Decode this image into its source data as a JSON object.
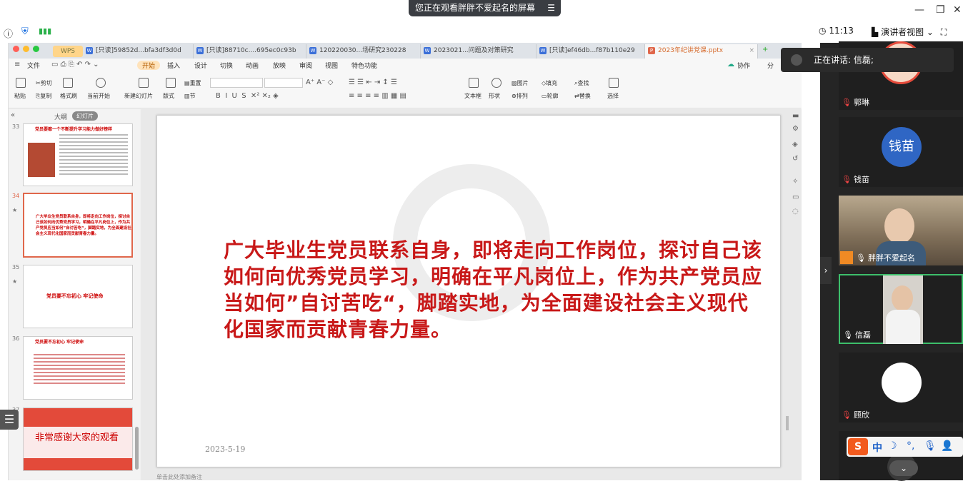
{
  "meeting": {
    "share_banner": "您正在观看胖胖不爱起名的屏幕",
    "banner_menu_icon": "menu-icon",
    "time": "11:13",
    "presenter_view_label": "演讲者视图",
    "speaking_label": "正在讲话:  信磊;"
  },
  "wps": {
    "app_tab": "WPS",
    "tabs": [
      "[只读]59852d...bfa3df3d0d",
      "[只读]88710c....695ec0c93b",
      "120220030...场研究230228",
      "2023021...问题及对策研究",
      "[只读]ef46db...f87b110e29",
      "2023年纪讲党课.pptx"
    ],
    "menu": [
      "文件",
      "开始",
      "插入",
      "设计",
      "切换",
      "动画",
      "放映",
      "审阅",
      "视图",
      "特色功能"
    ],
    "menu_right": [
      "协作",
      "分"
    ],
    "ribbon": {
      "paste": "粘贴",
      "cut": "剪切",
      "copy": "复制",
      "format_brush": "格式刷",
      "play_from_current": "当前开始",
      "new_slide": "新建幻灯片",
      "layout": "版式",
      "section": "节",
      "reset": "重置",
      "textbox": "文本框",
      "shape": "形状",
      "arrange": "排列",
      "picture": "图片",
      "fill": "填充",
      "outline": "轮廓",
      "find": "查找",
      "replace": "替换",
      "select": "选择"
    },
    "panel_tabs": {
      "outline": "大纲",
      "slides": "幻灯片"
    },
    "slides": [
      {
        "num": "33",
        "title": "党员要都一个不断提升学习能力做好榜样"
      },
      {
        "num": "34",
        "text": "广大毕业生党员联系自身，即将走向工作岗位，探讨自己该如何向优秀党员学习，明确在平凡岗位上，作为共产党员应当如何”自讨苦吃“，脚踏实地，为全面建设社会主义现代化国家而贡献青春力量。"
      },
      {
        "num": "35",
        "text": "党员要不忘初心 牢记使命"
      },
      {
        "num": "36",
        "title": "党员要不忘初心 牢记使命"
      },
      {
        "num": "37",
        "text": "非常感谢大家的观看"
      }
    ],
    "current_slide": {
      "body": "广大毕业生党员联系自身，即将走向工作岗位，探讨自己该如何向优秀党员学习，明确在平凡岗位上，作为共产党员应当如何”自讨苦吃“，脚踏实地，为全面建设社会主义现代化国家而贡献青春力量。",
      "date": "2023-5-19"
    },
    "status_text": "单击此处添加备注"
  },
  "participants": [
    {
      "name": "郭琳",
      "muted": true
    },
    {
      "name": "钱苗",
      "avatar_text": "钱苗",
      "muted": true
    },
    {
      "name": "胖胖不爱起名",
      "muted": false
    },
    {
      "name": "信磊",
      "muted": false
    },
    {
      "name": "顾欣",
      "muted": true
    }
  ],
  "ime": {
    "lang": "中"
  },
  "colors": {
    "slide_text": "#c81818",
    "panel_bg": "#252525",
    "active_speaker_border": "#3dbf6b",
    "qianmiao_avatar": "#2f66c4"
  }
}
